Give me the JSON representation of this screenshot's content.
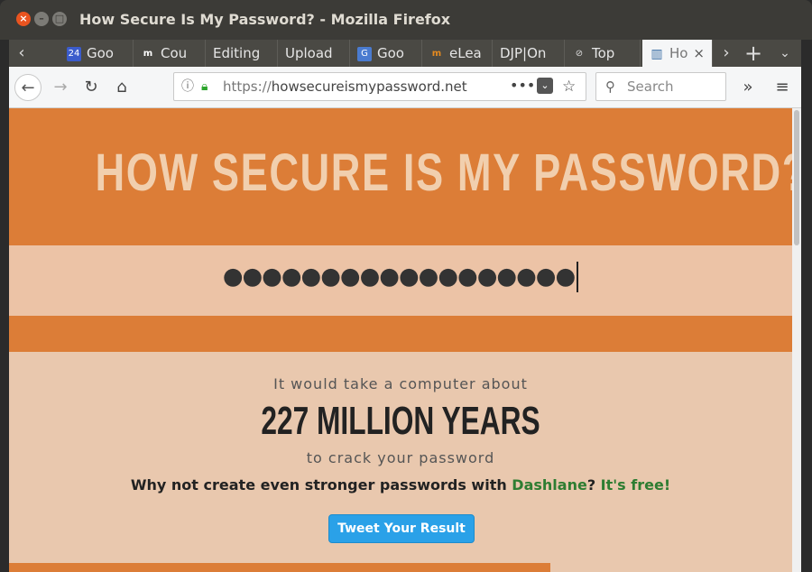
{
  "window": {
    "title": "How Secure Is My Password? - Mozilla Firefox"
  },
  "tabs": [
    {
      "label": "Goo",
      "favicon": "24",
      "favicon_color": "#3b5ccc"
    },
    {
      "label": "Cou",
      "favicon": "m",
      "favicon_color": "#444"
    },
    {
      "label": "Editing",
      "favicon": "",
      "favicon_color": ""
    },
    {
      "label": "Upload",
      "favicon": "",
      "favicon_color": ""
    },
    {
      "label": "Goo",
      "favicon": "G",
      "favicon_color": "#4a7bd0"
    },
    {
      "label": "eLea",
      "favicon": "m",
      "favicon_color": "#e58a1f"
    },
    {
      "label": "DJP|On",
      "favicon": "",
      "favicon_color": ""
    },
    {
      "label": "Top",
      "favicon": "⊘",
      "favicon_color": "#666"
    },
    {
      "label": "Ho",
      "favicon": "▥",
      "favicon_color": "#3b6ea5",
      "active": true
    }
  ],
  "navbar": {
    "url_protocol": "https://",
    "url_host": "howsecureismypassword.net",
    "search_placeholder": "Search"
  },
  "page": {
    "title": "HOW SECURE IS MY PASSWORD?",
    "password_masked": "●●●●●●●●●●●●●●●●●●",
    "lead": "It would take a computer about",
    "time": "227 MILLION YEARS",
    "tail": "to crack your password",
    "promo_prefix": "Why not create even stronger passwords with ",
    "promo_brand": "Dashlane",
    "promo_mid": "? ",
    "promo_free": "It's free!",
    "tweet_label": "Tweet Your Result"
  },
  "colors": {
    "accent_orange": "#dc7d37",
    "page_bg": "#e9c8ae",
    "tweet_blue": "#2aa1e8"
  }
}
